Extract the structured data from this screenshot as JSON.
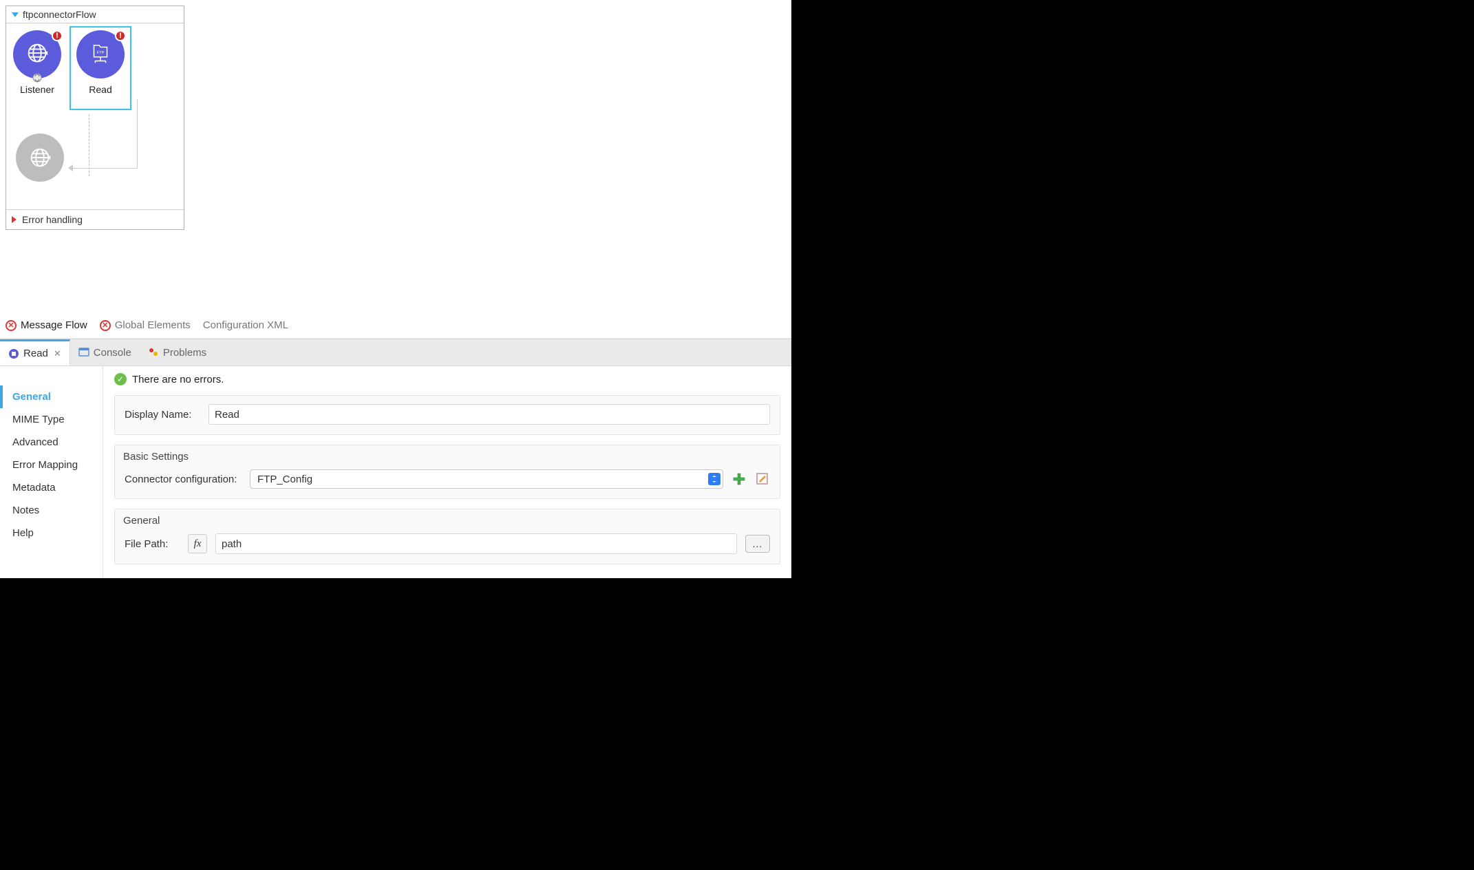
{
  "flow": {
    "title": "ftpconnectorFlow",
    "nodes": {
      "listener": {
        "label": "Listener",
        "hasError": true
      },
      "read": {
        "label": "Read",
        "hasError": true
      }
    },
    "errorHandling": "Error handling"
  },
  "editorTabs": {
    "messageFlow": "Message Flow",
    "globalElements": "Global Elements",
    "configXml": "Configuration XML"
  },
  "bottomTabs": {
    "read": "Read",
    "console": "Console",
    "problems": "Problems"
  },
  "sideTabs": {
    "general": "General",
    "mime": "MIME Type",
    "advanced": "Advanced",
    "errorMapping": "Error Mapping",
    "metadata": "Metadata",
    "notes": "Notes",
    "help": "Help"
  },
  "status": {
    "message": "There are no errors."
  },
  "form": {
    "displayNameLabel": "Display Name:",
    "displayNameValue": "Read",
    "basicSettings": "Basic Settings",
    "connectorConfigLabel": "Connector configuration:",
    "connectorConfigValue": "FTP_Config",
    "generalSection": "General",
    "filePathLabel": "File Path:",
    "filePathValue": "path",
    "browse": "...",
    "fx": "fx"
  }
}
